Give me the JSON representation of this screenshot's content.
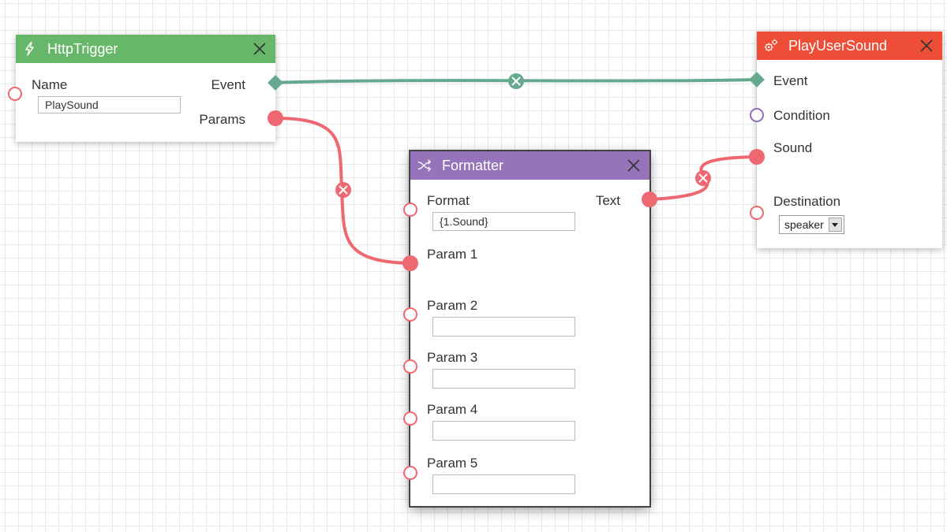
{
  "colors": {
    "trigger_header": "#66b769",
    "formatter_header": "#9674b9",
    "action_header": "#ee4e38",
    "wire_event": "#66a98e",
    "wire_param": "#ee6872"
  },
  "nodes": {
    "http_trigger": {
      "title": "HttpTrigger",
      "icon": "lightning-icon",
      "name_label": "Name",
      "name_value": "PlaySound",
      "event_label": "Event",
      "params_label": "Params"
    },
    "formatter": {
      "title": "Formatter",
      "icon": "shuffle-icon",
      "format_label": "Format",
      "format_value": "{1.Sound}",
      "text_label": "Text",
      "params": [
        {
          "label": "Param 1",
          "value": ""
        },
        {
          "label": "Param 2",
          "value": ""
        },
        {
          "label": "Param 3",
          "value": ""
        },
        {
          "label": "Param 4",
          "value": ""
        },
        {
          "label": "Param 5",
          "value": ""
        }
      ]
    },
    "play_user_sound": {
      "title": "PlayUserSound",
      "icon": "gears-icon",
      "event_label": "Event",
      "condition_label": "Condition",
      "sound_label": "Sound",
      "destination_label": "Destination",
      "destination_value": "speaker"
    }
  }
}
